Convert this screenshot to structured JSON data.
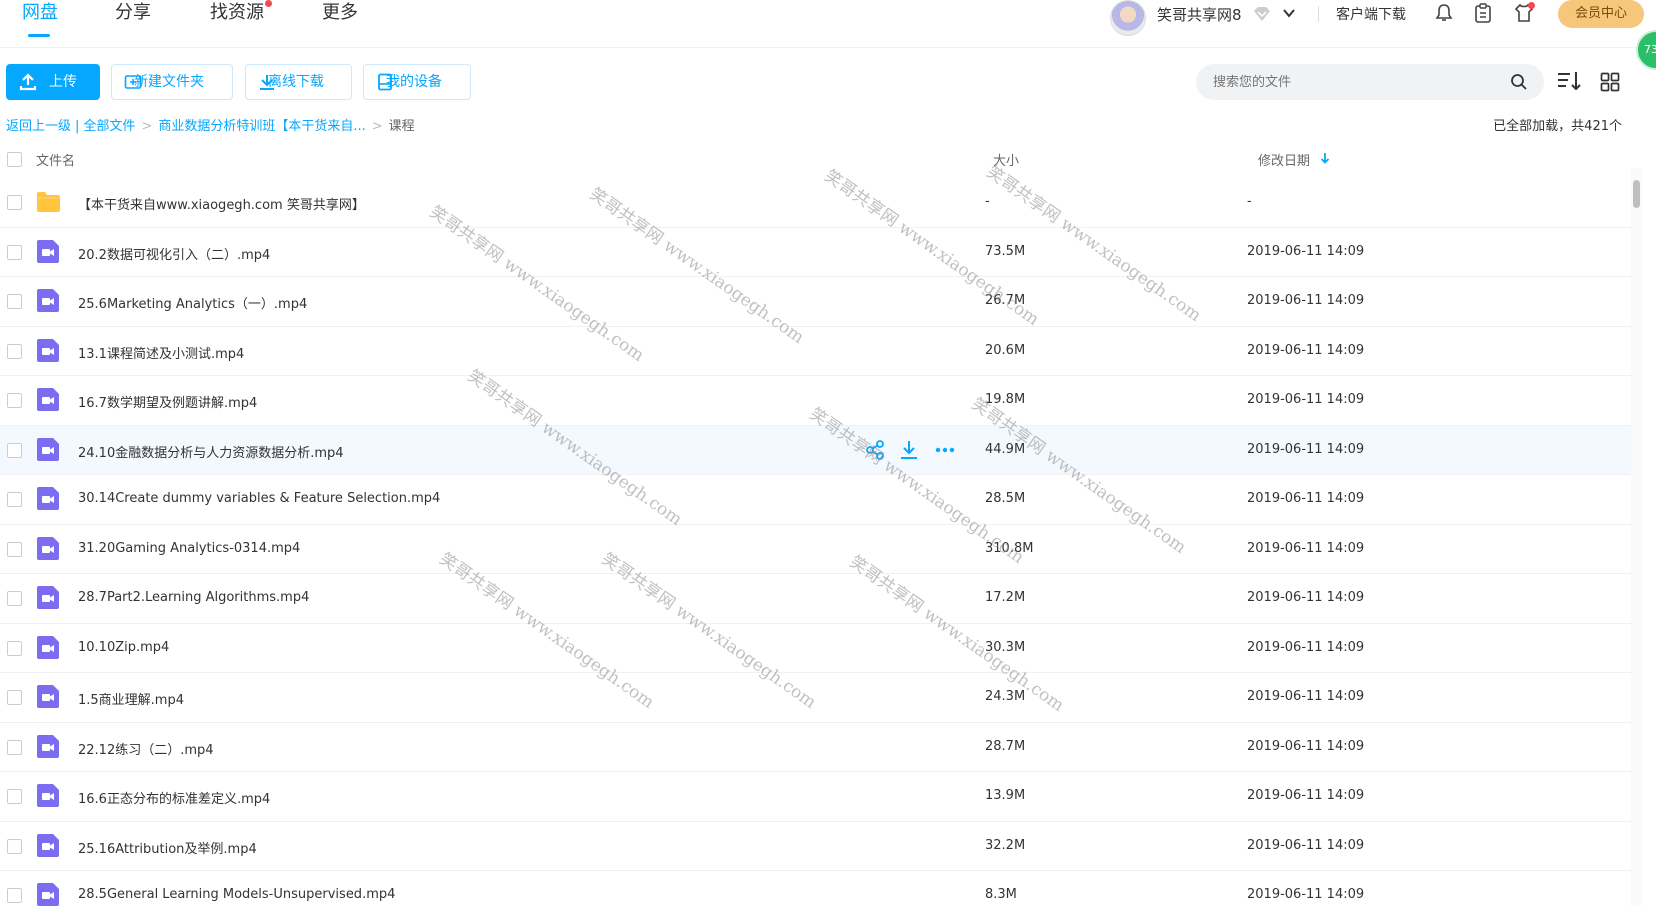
{
  "nav": {
    "tabs": [
      {
        "label": "网盘",
        "active": true
      },
      {
        "label": "分享",
        "active": false
      },
      {
        "label": "找资源",
        "active": false,
        "dot": true
      },
      {
        "label": "更多",
        "active": false
      }
    ],
    "username": "笑哥共享网8",
    "client_download": "客户端下载",
    "vip_center": "会员中心",
    "float_badge": "73"
  },
  "toolbar": {
    "upload": "上传",
    "new_folder": "新建文件夹",
    "offline_download": "离线下载",
    "my_devices": "我的设备",
    "search_placeholder": "搜索您的文件"
  },
  "breadcrumb": {
    "back": "返回上一级",
    "all_files": "全部文件",
    "parent": "商业数据分析特训班【本干货来自...",
    "current": "课程"
  },
  "status": {
    "loaded": "已全部加载，共421个"
  },
  "table": {
    "columns": {
      "name": "文件名",
      "size": "大小",
      "modified": "修改日期"
    },
    "rows": [
      {
        "name": "【本干货来自www.xiaogegh.com 笑哥共享网】",
        "size": "-",
        "date": "-",
        "type": "folder"
      },
      {
        "name": "20.2数据可视化引入（二）.mp4",
        "size": "73.5M",
        "date": "2019-06-11 14:09",
        "type": "video"
      },
      {
        "name": "25.6Marketing Analytics（一）.mp4",
        "size": "26.7M",
        "date": "2019-06-11 14:09",
        "type": "video"
      },
      {
        "name": "13.1课程简述及小测试.mp4",
        "size": "20.6M",
        "date": "2019-06-11 14:09",
        "type": "video"
      },
      {
        "name": "16.7数学期望及例题讲解.mp4",
        "size": "19.8M",
        "date": "2019-06-11 14:09",
        "type": "video"
      },
      {
        "name": "24.10金融数据分析与人力资源数据分析.mp4",
        "size": "44.9M",
        "date": "2019-06-11 14:09",
        "type": "video",
        "hover": true
      },
      {
        "name": "30.14Create dummy variables & Feature Selection.mp4",
        "size": "28.5M",
        "date": "2019-06-11 14:09",
        "type": "video"
      },
      {
        "name": "31.20Gaming Analytics-0314.mp4",
        "size": "310.8M",
        "date": "2019-06-11 14:09",
        "type": "video"
      },
      {
        "name": "28.7Part2.Learning Algorithms.mp4",
        "size": "17.2M",
        "date": "2019-06-11 14:09",
        "type": "video"
      },
      {
        "name": "10.10Zip.mp4",
        "size": "30.3M",
        "date": "2019-06-11 14:09",
        "type": "video"
      },
      {
        "name": "1.5商业理解.mp4",
        "size": "24.3M",
        "date": "2019-06-11 14:09",
        "type": "video"
      },
      {
        "name": "22.12练习（二）.mp4",
        "size": "28.7M",
        "date": "2019-06-11 14:09",
        "type": "video"
      },
      {
        "name": "16.6正态分布的标准差定义.mp4",
        "size": "13.9M",
        "date": "2019-06-11 14:09",
        "type": "video"
      },
      {
        "name": "25.16Attribution及举例.mp4",
        "size": "32.2M",
        "date": "2019-06-11 14:09",
        "type": "video"
      },
      {
        "name": "28.5General Learning Models-Unsupervised.mp4",
        "size": "8.3M",
        "date": "2019-06-11 14:09",
        "type": "video"
      }
    ]
  },
  "watermark": "笑哥共享网 www.xiaogegh.com",
  "colors": {
    "accent": "#06a7ff",
    "video_icon": "#7b6cf0",
    "folder_icon": "#ffc53d",
    "vip": "#f6c77a"
  }
}
